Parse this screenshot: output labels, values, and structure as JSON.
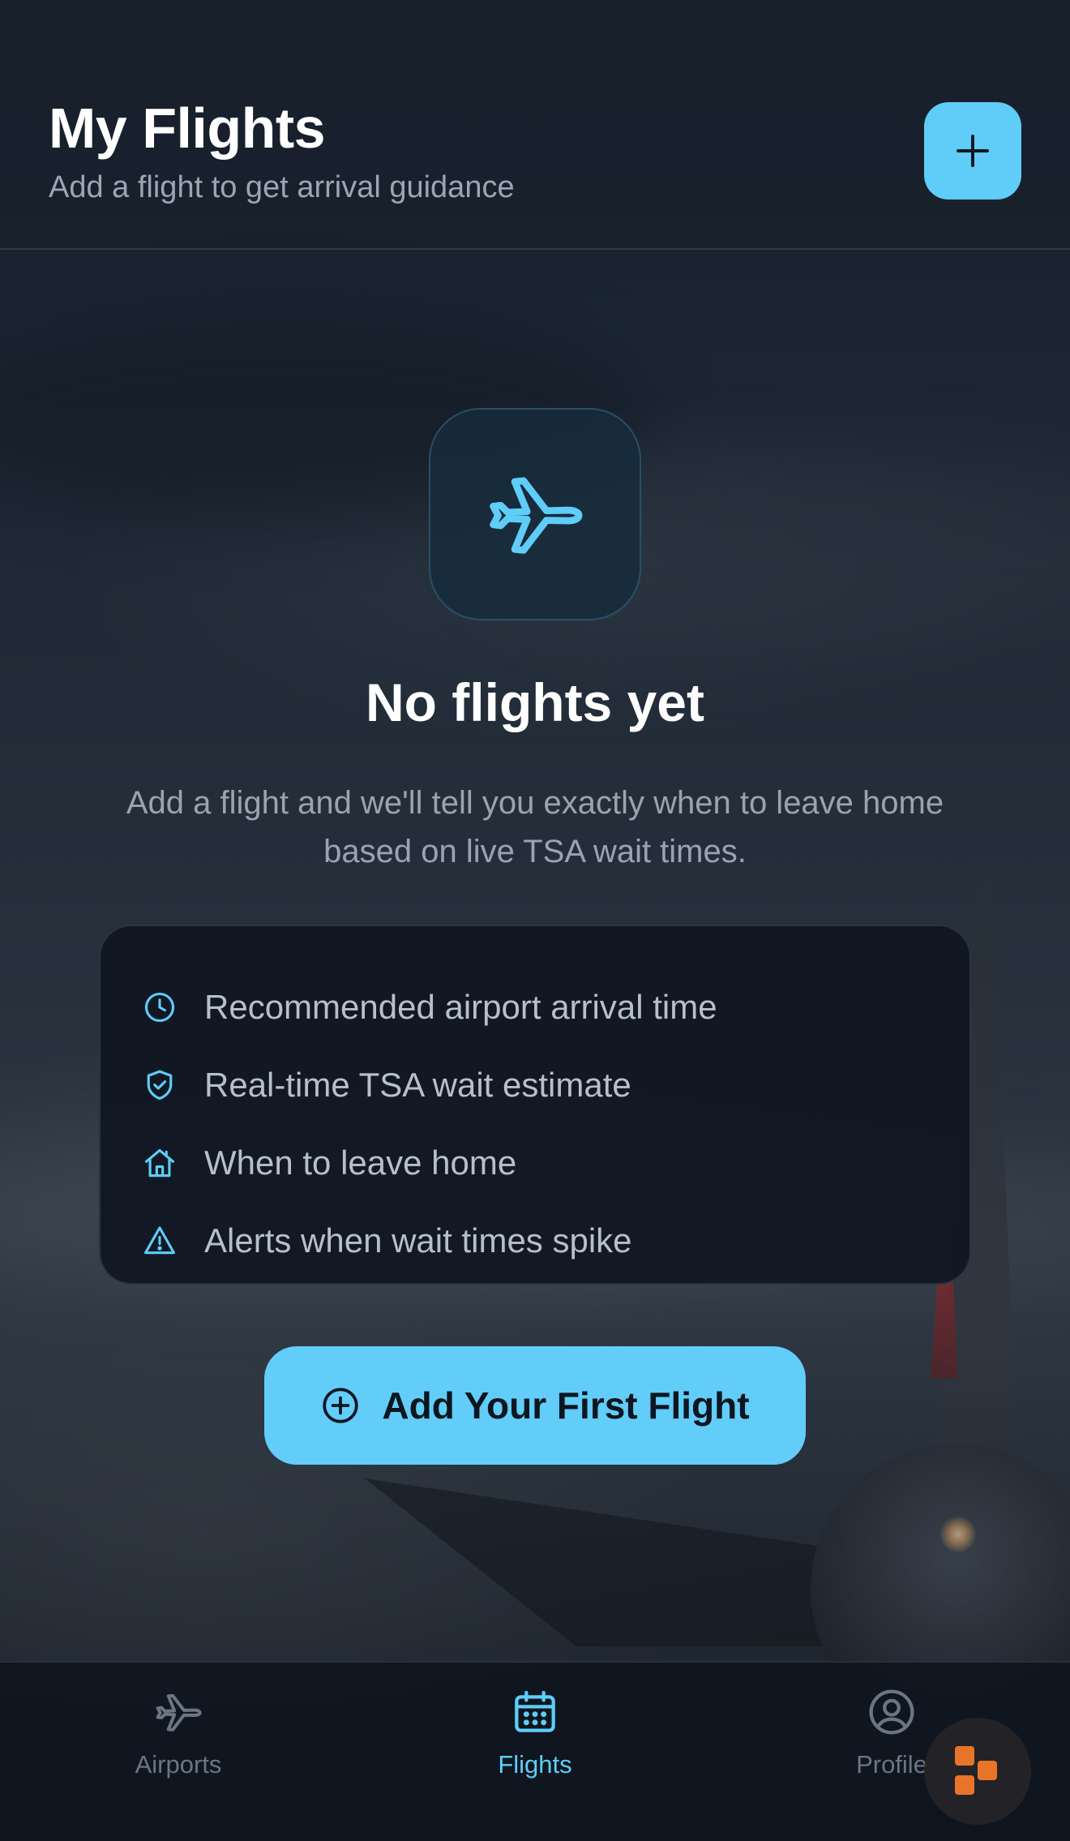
{
  "header": {
    "title": "My Flights",
    "subtitle": "Add a flight to get arrival guidance",
    "add_button_icon": "plus-icon"
  },
  "empty_state": {
    "icon": "airplane-icon",
    "title": "No flights yet",
    "description": "Add a flight and we'll tell you exactly when to leave home based on live TSA wait times."
  },
  "features": [
    {
      "icon": "clock-icon",
      "label": "Recommended airport arrival time"
    },
    {
      "icon": "shield-check-icon",
      "label": "Real-time TSA wait estimate"
    },
    {
      "icon": "home-icon",
      "label": "When to leave home"
    },
    {
      "icon": "alert-triangle-icon",
      "label": "Alerts when wait times spike"
    }
  ],
  "cta": {
    "label": "Add Your First Flight",
    "icon": "plus-circle-icon"
  },
  "nav": {
    "items": [
      {
        "label": "Airports",
        "icon": "airplane-icon",
        "active": false
      },
      {
        "label": "Flights",
        "icon": "calendar-icon",
        "active": true
      },
      {
        "label": "Profile",
        "icon": "user-circle-icon",
        "active": false
      }
    ]
  },
  "colors": {
    "accent": "#5fcdf7",
    "background": "#1f2a37",
    "card": "#101622",
    "text_muted": "#9aa3b0",
    "fab_logo": "#e8742a"
  }
}
